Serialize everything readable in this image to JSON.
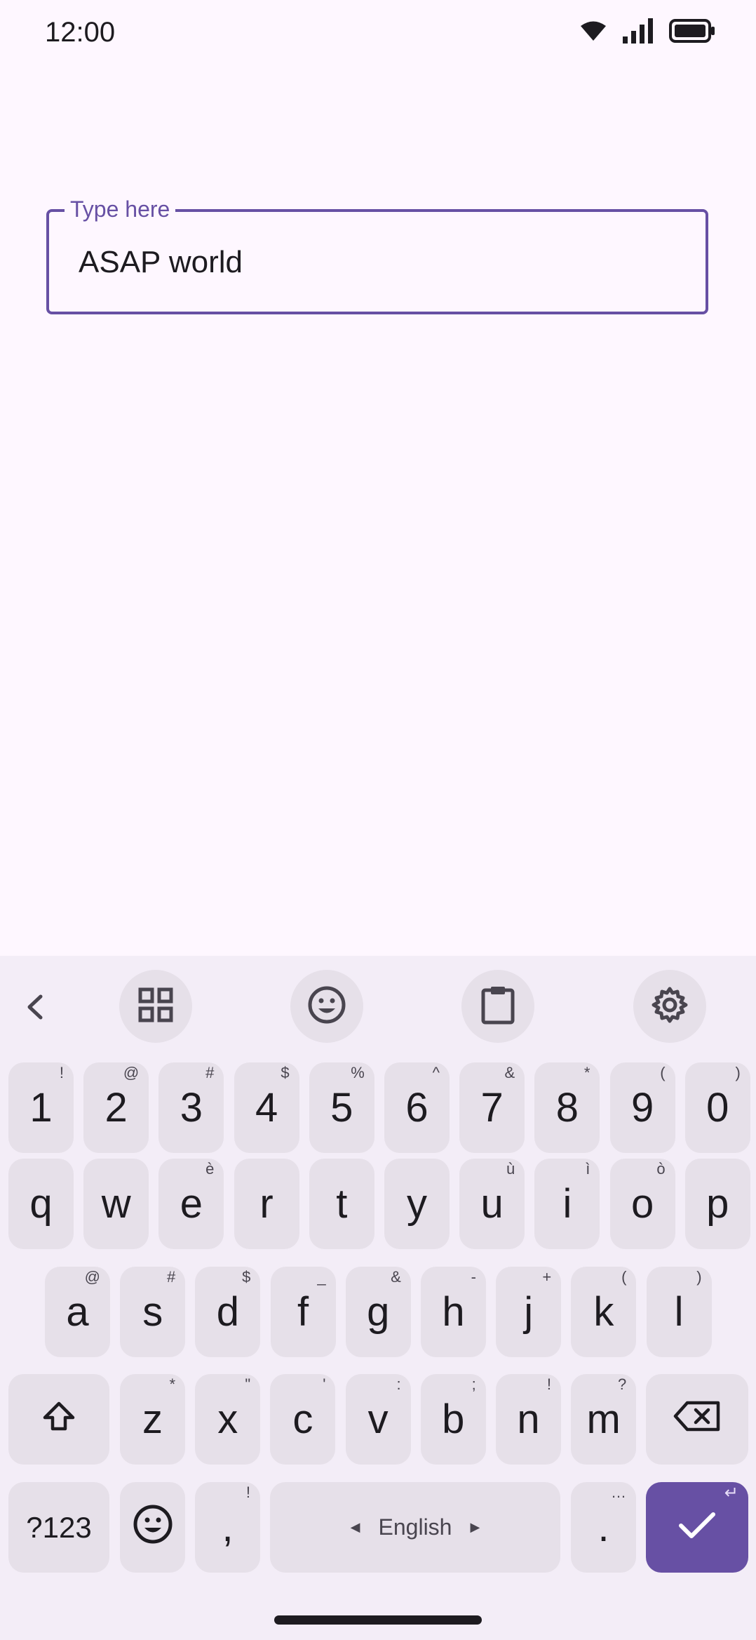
{
  "status_bar": {
    "time": "12:00",
    "icons": [
      "wifi-icon",
      "signal-icon",
      "battery-icon"
    ]
  },
  "text_field": {
    "label": "Type here",
    "value": "ASAP world"
  },
  "keyboard": {
    "toolbar": {
      "icons": [
        "chevron-left-icon",
        "grid-icon",
        "emoji-icon",
        "clipboard-icon",
        "gear-icon"
      ]
    },
    "rows": {
      "numbers": [
        {
          "main": "1",
          "hint": "!"
        },
        {
          "main": "2",
          "hint": "@"
        },
        {
          "main": "3",
          "hint": "#"
        },
        {
          "main": "4",
          "hint": "$"
        },
        {
          "main": "5",
          "hint": "%"
        },
        {
          "main": "6",
          "hint": "^"
        },
        {
          "main": "7",
          "hint": "&"
        },
        {
          "main": "8",
          "hint": "*"
        },
        {
          "main": "9",
          "hint": "("
        },
        {
          "main": "0",
          "hint": ")"
        }
      ],
      "row1": [
        {
          "main": "q",
          "hint": ""
        },
        {
          "main": "w",
          "hint": ""
        },
        {
          "main": "e",
          "hint": "è"
        },
        {
          "main": "r",
          "hint": ""
        },
        {
          "main": "t",
          "hint": ""
        },
        {
          "main": "y",
          "hint": ""
        },
        {
          "main": "u",
          "hint": "ù"
        },
        {
          "main": "i",
          "hint": "ì"
        },
        {
          "main": "o",
          "hint": "ò"
        },
        {
          "main": "p",
          "hint": ""
        }
      ],
      "row2": [
        {
          "main": "a",
          "hint": "@"
        },
        {
          "main": "s",
          "hint": "#"
        },
        {
          "main": "d",
          "hint": "$"
        },
        {
          "main": "f",
          "hint": "_"
        },
        {
          "main": "g",
          "hint": "&"
        },
        {
          "main": "h",
          "hint": "-"
        },
        {
          "main": "j",
          "hint": "+"
        },
        {
          "main": "k",
          "hint": "("
        },
        {
          "main": "l",
          "hint": ")"
        }
      ],
      "row3": [
        {
          "main": "z",
          "hint": "*"
        },
        {
          "main": "x",
          "hint": "\""
        },
        {
          "main": "c",
          "hint": "'"
        },
        {
          "main": "v",
          "hint": ":"
        },
        {
          "main": "b",
          "hint": ";"
        },
        {
          "main": "n",
          "hint": "!"
        },
        {
          "main": "m",
          "hint": "?"
        }
      ]
    },
    "bottom": {
      "symbols_label": "?123",
      "comma": ",",
      "comma_hint": "!",
      "space_label": "English",
      "period": ".",
      "period_hint": "…",
      "enter_hint": "↵"
    },
    "accent_color": "#6750A4"
  }
}
